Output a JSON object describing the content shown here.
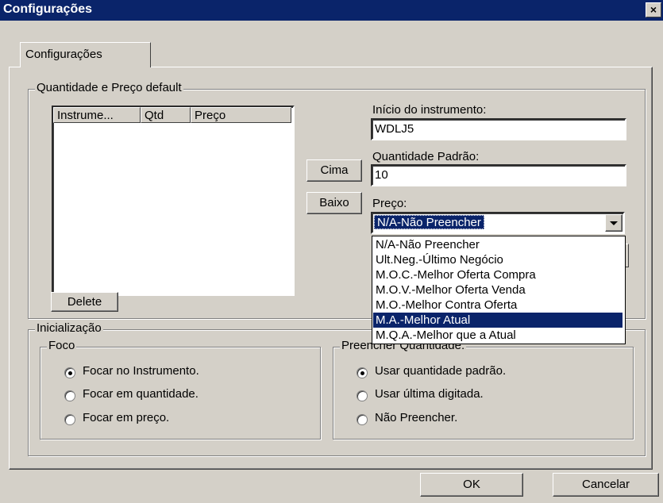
{
  "window": {
    "title": "Configurações",
    "close_glyph": "×"
  },
  "tabs": [
    {
      "label": "Configurações"
    }
  ],
  "group_defaults": {
    "label": "Quantidade e Preço default",
    "columns": [
      "Instrume...",
      "Qtd",
      "Preço"
    ],
    "delete_label": "Delete",
    "up_label": "Cima",
    "down_label": "Baixo",
    "instrument_label": "Início do instrumento:",
    "instrument_value": "WDLJ5",
    "qty_label": "Quantidade Padrão:",
    "qty_value": "10",
    "price_label": "Preço:",
    "price_selected": "N/A-Não Preencher",
    "price_options": [
      "N/A-Não Preencher",
      "Ult.Neg.-Último Negócio",
      "M.O.C.-Melhor Oferta Compra",
      "M.O.V.-Melhor Oferta Venda",
      "M.O.-Melhor Contra Oferta",
      "M.A.-Melhor Atual",
      "M.Q.A.-Melhor que a Atual"
    ],
    "price_highlighted": "M.A.-Melhor Atual"
  },
  "group_init": {
    "label": "Inicialização",
    "focus": {
      "label": "Foco",
      "options": [
        "Focar no Instrumento.",
        "Focar em quantidade.",
        "Focar em preço."
      ],
      "selected": "Focar no Instrumento."
    },
    "fill_qty": {
      "label": "Preencher Quantidade:",
      "options": [
        "Usar quantidade padrão.",
        "Usar última digitada.",
        "Não Preencher."
      ],
      "selected": "Usar quantidade padrão."
    }
  },
  "footer": {
    "ok_label": "OK",
    "cancel_label": "Cancelar"
  },
  "colors": {
    "titlebar": "#0a246a",
    "face": "#d4d0c8",
    "highlight": "#0a246a"
  }
}
